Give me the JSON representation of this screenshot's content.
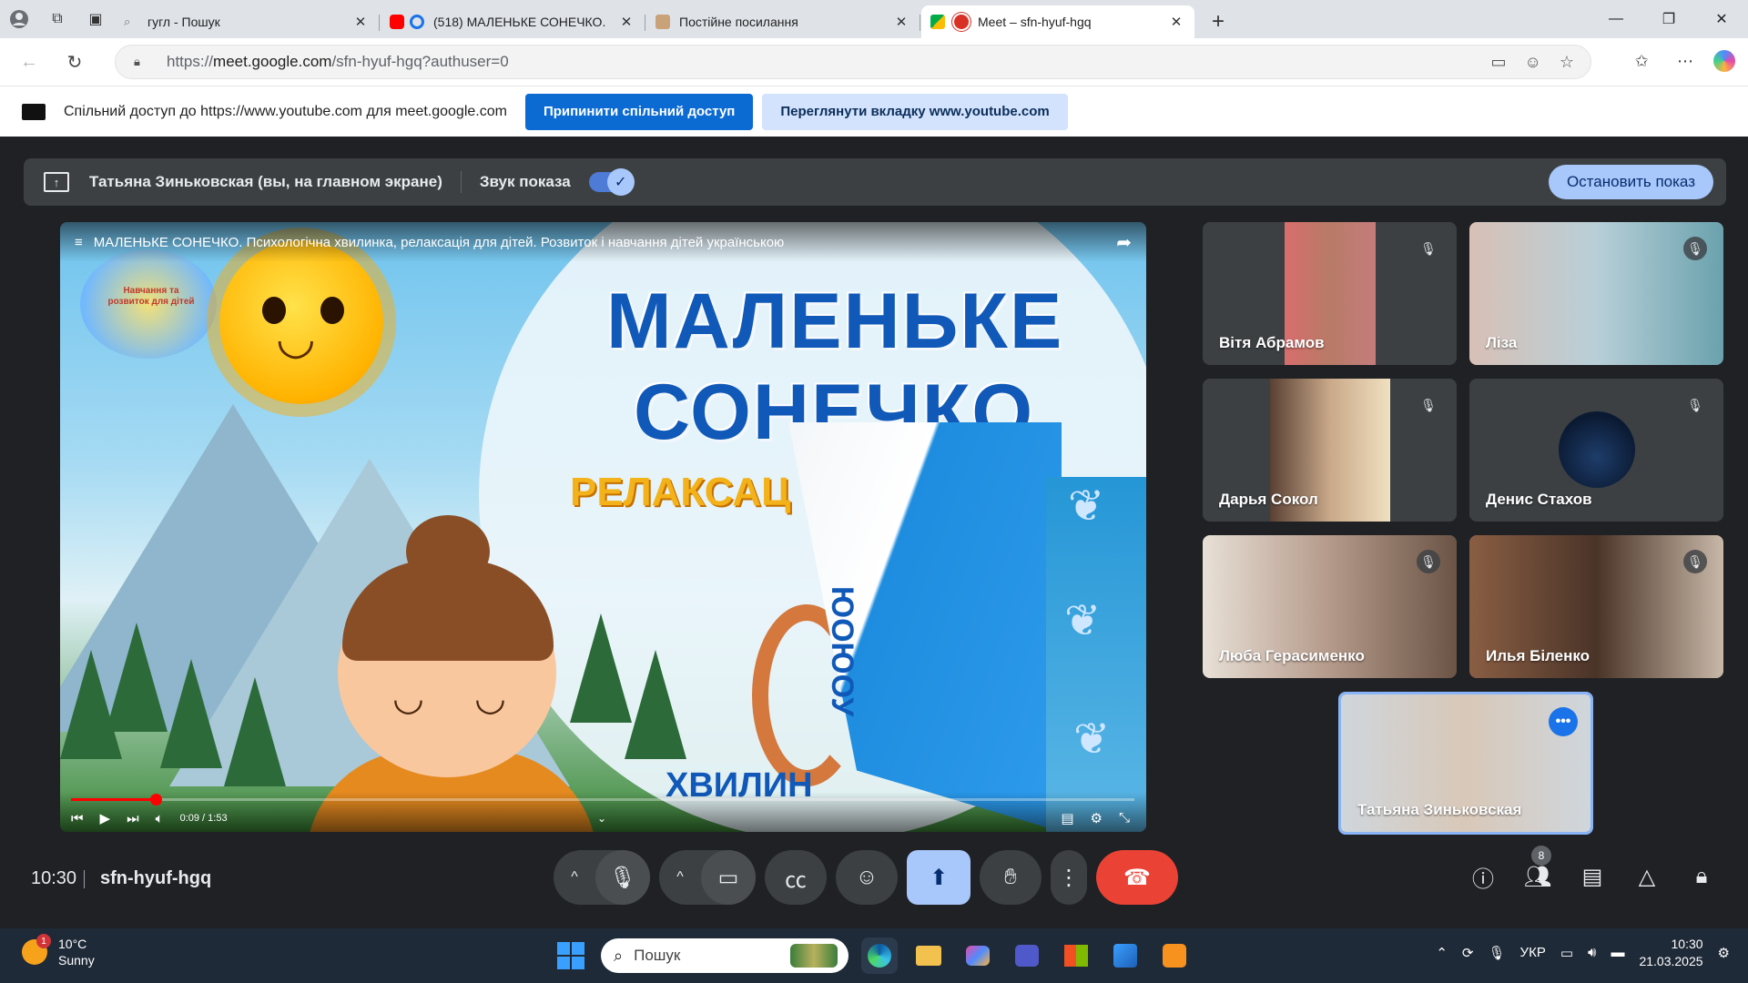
{
  "browser": {
    "tabs": [
      {
        "title": "гугл - Пошук",
        "favicon_color": "#dfe3e8"
      },
      {
        "title": "(518) МАЛЕНЬКЕ СОНЕЧКО.",
        "favicon_color": "#ff0000"
      },
      {
        "title": "Постійне посилання",
        "favicon_color": "#c9a27a"
      },
      {
        "title": "Meet – sfn-hyuf-hgq",
        "favicon_color": "#00ac47"
      }
    ],
    "url_prefix": "https://",
    "url_host": "meet.google.com",
    "url_path": "/sfn-hyuf-hgq?authuser=0"
  },
  "infobar": {
    "message": "Спільний доступ до https://www.youtube.com для meet.google.com",
    "stop_label": "Припинити спільний доступ",
    "view_label": "Переглянути вкладку www.youtube.com"
  },
  "present_bar": {
    "presenter": "Татьяна Зиньковская (вы, на главном экране)",
    "sound_label": "Звук показа",
    "sound_on": true,
    "stop_label": "Остановить показ"
  },
  "video": {
    "title": "МАЛЕНЬКЕ СОНЕЧКО. Психологічна хвилинка, релаксація для дітей. Розвиток і навчання дітей українською",
    "slide_title_line1": "МАЛЕНЬКЕ",
    "slide_title_line2": "СОНЕЧКО",
    "slide_subtitle": "РЕЛАКСАЦ",
    "slide_bottom": "ХВИЛИН",
    "curl_text": "ЮОЮОУ",
    "logo_text": "Навчання та розвиток для дітей",
    "time": "0:09 / 1:53",
    "progress": 0.08
  },
  "participants": [
    {
      "name": "Вітя Абрамов",
      "muted": true,
      "bg": "#b77b66"
    },
    {
      "name": "Ліза",
      "muted": true,
      "bg": "#b8cfd8"
    },
    {
      "name": "Дарья Сокол",
      "muted": true,
      "bg": "#c9a989"
    },
    {
      "name": "Денис Стахов",
      "muted": true,
      "bg": ""
    },
    {
      "name": "Люба Герасименко",
      "muted": true,
      "bg": "#b49a8a"
    },
    {
      "name": "Илья Біленко",
      "muted": true,
      "bg": "#8a5e43"
    },
    {
      "name": "Татьяна Зиньковская",
      "muted": false,
      "bg": "#cfd6dc"
    }
  ],
  "controls": {
    "time": "10:30",
    "meeting_code": "sfn-hyuf-hgq",
    "participant_count": "8"
  },
  "taskbar": {
    "weather_badge": "1",
    "temperature": "10°C",
    "condition": "Sunny",
    "search_placeholder": "Пошук",
    "language": "УКР",
    "clock_time": "10:30",
    "clock_date": "21.03.2025"
  }
}
